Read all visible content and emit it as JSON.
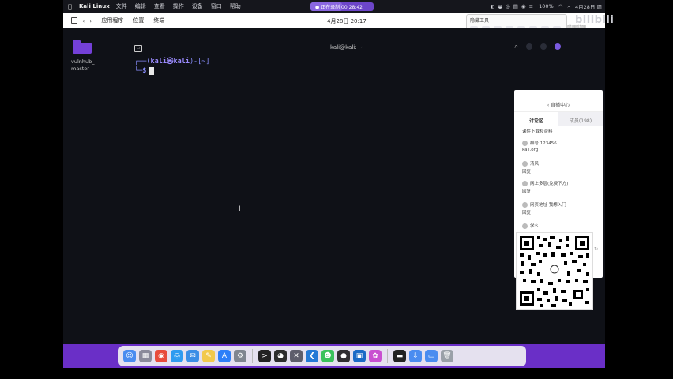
{
  "menubar": {
    "apple_glyph": "",
    "app_name": "Kali Linux",
    "items": [
      "文件",
      "编辑",
      "查看",
      "操作",
      "设备",
      "窗口",
      "帮助"
    ],
    "recording_label": "● 正在录制 00:28:42",
    "recording_progress": 0.5,
    "battery_pct": "100%",
    "date_time": "4月28日 周",
    "wifi_icon": "wifi-icon",
    "search_icon": "search-icon"
  },
  "kali_panel": {
    "items": [
      "应用程序",
      "位置",
      "终端"
    ],
    "clock": "4月28日  20:17"
  },
  "rec_toolbar": {
    "title": "隐藏工具",
    "tools": [
      "□",
      "✎",
      "◇",
      "T",
      "↶",
      "↷",
      "⤓",
      "⊞"
    ]
  },
  "bilibili": {
    "prefix": "哔哩哔哩",
    "logo": "bilibili"
  },
  "desktop": {
    "folder_label_line1": "vulnhub_",
    "folder_label_line2": "master"
  },
  "terminal": {
    "title": "kali@kali: ~",
    "prompt_open": "┌──(",
    "prompt_user": "kali㉿kali",
    "prompt_close": ")-[~]",
    "prompt_line2": "└─",
    "prompt_dollar": "$"
  },
  "panel": {
    "header": "‹ 直播中心",
    "tabs": [
      "讨论区",
      "成员(198)"
    ],
    "lines": [
      "课件下载和资料",
      "群号 123456",
      "kali.org",
      "清风",
      "回复",
      "网上多层(免费下方)",
      "回复",
      "网页地址 我想入门",
      "回复",
      "学么"
    ]
  },
  "dock": {
    "icons": [
      {
        "name": "finder-icon",
        "color": "#4a8cf0",
        "glyph": "☺"
      },
      {
        "name": "launchpad-icon",
        "color": "#8a8a9a",
        "glyph": "▦"
      },
      {
        "name": "chrome-icon",
        "color": "#e84b3c",
        "glyph": "◉"
      },
      {
        "name": "safari-icon",
        "color": "#2f9bf0",
        "glyph": "◎"
      },
      {
        "name": "mail-icon",
        "color": "#3a8ee6",
        "glyph": "✉"
      },
      {
        "name": "notes-icon",
        "color": "#f2c94c",
        "glyph": "✎"
      },
      {
        "name": "appstore-icon",
        "color": "#2d7ff9",
        "glyph": "A"
      },
      {
        "name": "settings-icon",
        "color": "#7f8590",
        "glyph": "⚙"
      },
      {
        "name": "terminal-icon",
        "color": "#222222",
        "glyph": ">"
      },
      {
        "name": "qq-icon",
        "color": "#2d2d2d",
        "glyph": "◕"
      },
      {
        "name": "tools-icon",
        "color": "#5d5d6b",
        "glyph": "✕"
      },
      {
        "name": "vscode-icon",
        "color": "#2479d6",
        "glyph": "❮"
      },
      {
        "name": "wechat-icon",
        "color": "#3ac25b",
        "glyph": "☻"
      },
      {
        "name": "obs-icon",
        "color": "#302e31",
        "glyph": "●"
      },
      {
        "name": "virtualbox-icon",
        "color": "#1b6ac6",
        "glyph": "▣"
      },
      {
        "name": "sequel-icon",
        "color": "#c94fd0",
        "glyph": "✿"
      },
      {
        "name": "terminal2-icon",
        "color": "#222222",
        "glyph": "▬"
      },
      {
        "name": "downloads-icon",
        "color": "#4a8cf0",
        "glyph": "⇩"
      },
      {
        "name": "folder-icon",
        "color": "#4a8cf0",
        "glyph": "▭"
      },
      {
        "name": "trash-icon",
        "color": "#9aa0a8",
        "glyph": "🗑"
      }
    ]
  }
}
